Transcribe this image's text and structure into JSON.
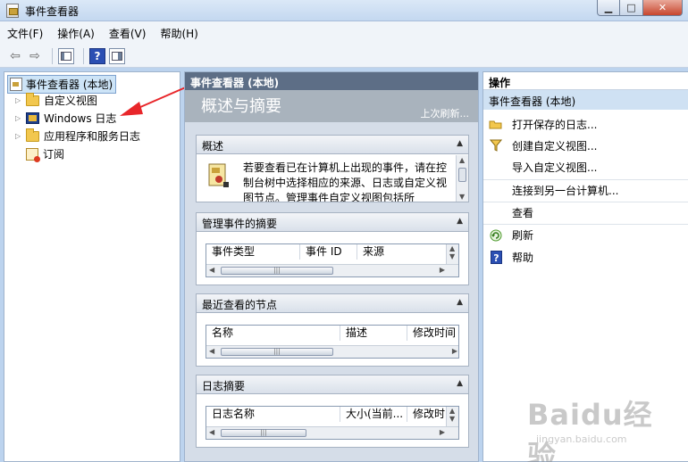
{
  "window": {
    "title": "事件查看器"
  },
  "menubar": {
    "items": [
      "文件(F)",
      "操作(A)",
      "查看(V)",
      "帮助(H)"
    ]
  },
  "toolbar": {
    "icons": [
      "back-arrow-icon",
      "forward-arrow-icon",
      "console-tree-icon",
      "help-icon",
      "action-pane-icon"
    ]
  },
  "tree": {
    "root": "事件查看器 (本地)",
    "items": [
      {
        "label": "自定义视图",
        "icon": "folder-icon",
        "expandable": true
      },
      {
        "label": "Windows 日志",
        "icon": "windows-log-icon",
        "expandable": true
      },
      {
        "label": "应用程序和服务日志",
        "icon": "folder-icon",
        "expandable": true
      },
      {
        "label": "订阅",
        "icon": "subscription-icon",
        "expandable": false
      }
    ]
  },
  "center": {
    "header": "事件查看器 (本地)",
    "band_title": "概述与摘要",
    "band_subtitle": "上次刷新...",
    "sections": {
      "overview": {
        "title": "概述",
        "text": "若要查看已在计算机上出现的事件，请在控制台树中选择相应的来源、日志或自定义视图节点。管理事件自定义视图包括所"
      },
      "admin_summary": {
        "title": "管理事件的摘要",
        "columns": [
          "事件类型",
          "事件 ID",
          "来源"
        ]
      },
      "recent_nodes": {
        "title": "最近查看的节点",
        "columns": [
          "名称",
          "描述",
          "修改时间"
        ]
      },
      "log_summary": {
        "title": "日志摘要",
        "columns": [
          "日志名称",
          "大小(当前...",
          "修改时"
        ]
      }
    }
  },
  "actions": {
    "header": "操作",
    "subheader": "事件查看器 (本地)",
    "items": [
      {
        "label": "打开保存的日志...",
        "icon": "open-folder-icon"
      },
      {
        "label": "创建自定义视图...",
        "icon": "filter-icon"
      },
      {
        "label": "导入自定义视图...",
        "icon": ""
      },
      {
        "label": "连接到另一台计算机...",
        "icon": ""
      },
      {
        "label": "查看",
        "icon": ""
      },
      {
        "label": "刷新",
        "icon": "refresh-icon"
      },
      {
        "label": "帮助",
        "icon": "help-icon"
      }
    ]
  },
  "watermark": {
    "text": "Baidu经验",
    "url": "jingyan.baidu.com"
  },
  "colors": {
    "selection": "#cde4f7",
    "pane_header": "#5d6e86",
    "arrow": "#e8262a"
  }
}
